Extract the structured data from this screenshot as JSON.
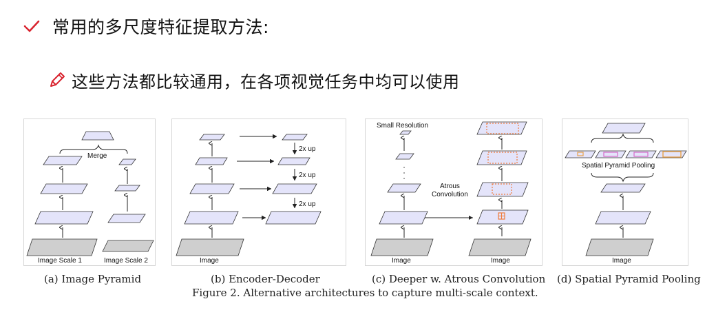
{
  "slide": {
    "heading": "常用的多尺度特征提取方法:",
    "subpoint": "这些方法都比较通用，在各项视觉任务中均可以使用",
    "heading_icon": "checkmark-icon",
    "subpoint_icon": "pencil-icon",
    "accent_color": "#d9242f"
  },
  "figure": {
    "caption": "Figure 2. Alternative architectures to capture multi-scale context.",
    "panels": [
      {
        "caption": "(a) Image Pyramid",
        "labels": {
          "merge": "Merge",
          "scale1": "Image Scale 1",
          "scale2": "Image Scale 2"
        }
      },
      {
        "caption": "(b) Encoder-Decoder",
        "labels": {
          "image": "Image",
          "up1": "2x up",
          "up2": "2x up",
          "up3": "2x up"
        }
      },
      {
        "caption": "(c) Deeper w. Atrous Convolution",
        "labels": {
          "small_res": "Small Resolution",
          "atrous_1": "Atrous",
          "atrous_2": "Convolution",
          "image_left": "Image",
          "image_right": "Image"
        }
      },
      {
        "caption": "(d) Spatial Pyramid Pooling",
        "labels": {
          "spp": "Spatial Pyramid Pooling",
          "image": "Image"
        }
      }
    ],
    "colors": {
      "feature_fill": "#e4e4fa",
      "image_fill": "#cfcfcf",
      "atrous_dots": "#f07a3a",
      "pool_orange": "#e8a24a",
      "pool_magenta": "#d868c8"
    }
  }
}
